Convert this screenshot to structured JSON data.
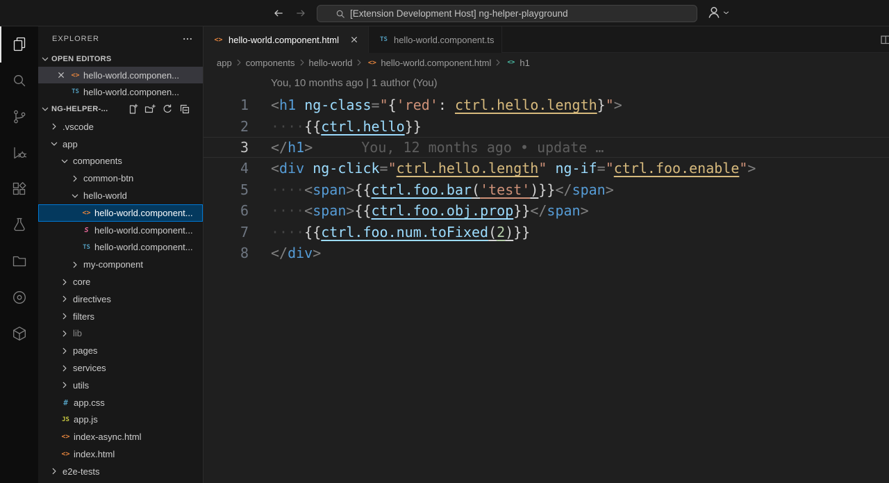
{
  "titlebar": {
    "search_text": "[Extension Development Host] ng-helper-playground"
  },
  "colors": {
    "accent": "#0078d4",
    "selection_bg": "#04395e",
    "html_icon": "#e0823d",
    "ts_icon": "#519aba",
    "js_icon": "#cbcb41",
    "style_icon": "#ec6a9c"
  },
  "activitybar": {
    "items": [
      {
        "name": "explorer-icon",
        "icon": "files",
        "active": true
      },
      {
        "name": "search-icon",
        "icon": "search"
      },
      {
        "name": "source-control-icon",
        "icon": "scm"
      },
      {
        "name": "run-debug-icon",
        "icon": "debug"
      },
      {
        "name": "extensions-icon",
        "icon": "ext"
      },
      {
        "name": "testing-icon",
        "icon": "beaker"
      },
      {
        "name": "folder-view-icon",
        "icon": "folder"
      },
      {
        "name": "live-preview-icon",
        "icon": "circle"
      },
      {
        "name": "package-icon",
        "icon": "cube"
      }
    ]
  },
  "sidebar": {
    "title": "EXPLORER",
    "open_editors_label": "OPEN EDITORS",
    "section_label": "NG-HELPER-...",
    "open_editors": [
      {
        "icon": "html",
        "label": "hello-world.componen...",
        "close": true,
        "active": true
      },
      {
        "icon": "ts",
        "label": "hello-world.componen..."
      }
    ],
    "tree": [
      {
        "indent": 0,
        "chevron": "right",
        "label": ".vscode"
      },
      {
        "indent": 0,
        "chevron": "down",
        "label": "app"
      },
      {
        "indent": 1,
        "chevron": "down",
        "label": "components"
      },
      {
        "indent": 2,
        "chevron": "right",
        "label": "common-btn"
      },
      {
        "indent": 2,
        "chevron": "down",
        "label": "hello-world"
      },
      {
        "indent": 3,
        "icon": "html",
        "label": "hello-world.component...",
        "selected": true
      },
      {
        "indent": 3,
        "icon": "style",
        "label": "hello-world.component..."
      },
      {
        "indent": 3,
        "icon": "ts",
        "label": "hello-world.component..."
      },
      {
        "indent": 2,
        "chevron": "right",
        "label": "my-component"
      },
      {
        "indent": 1,
        "chevron": "right",
        "label": "core"
      },
      {
        "indent": 1,
        "chevron": "right",
        "label": "directives"
      },
      {
        "indent": 1,
        "chevron": "right",
        "label": "filters"
      },
      {
        "indent": 1,
        "chevron": "right",
        "label": "lib",
        "dim": true
      },
      {
        "indent": 1,
        "chevron": "right",
        "label": "pages"
      },
      {
        "indent": 1,
        "chevron": "right",
        "label": "services"
      },
      {
        "indent": 1,
        "chevron": "right",
        "label": "utils"
      },
      {
        "indent": 1,
        "icon": "css",
        "label": "app.css"
      },
      {
        "indent": 1,
        "icon": "js",
        "label": "app.js"
      },
      {
        "indent": 1,
        "icon": "html",
        "label": "index-async.html"
      },
      {
        "indent": 1,
        "icon": "html",
        "label": "index.html"
      },
      {
        "indent": 0,
        "chevron": "right",
        "label": "e2e-tests"
      }
    ]
  },
  "editor": {
    "tabs": [
      {
        "icon": "html",
        "label": "hello-world.component.html",
        "active": true,
        "close": true
      },
      {
        "icon": "ts",
        "label": "hello-world.component.ts"
      }
    ],
    "breadcrumbs": [
      {
        "label": "app"
      },
      {
        "label": "components"
      },
      {
        "label": "hello-world"
      },
      {
        "icon": "html",
        "label": "hello-world.component.html"
      },
      {
        "icon": "sym",
        "label": "h1"
      }
    ],
    "codelens": "You, 10 months ago | 1 author (You)",
    "lines": [
      {
        "num": 1,
        "tokens": [
          {
            "t": "<",
            "c": "pun"
          },
          {
            "t": "h1",
            "c": "tag"
          },
          {
            "t": " ",
            "c": "pln"
          },
          {
            "t": "ng-class",
            "c": "attr"
          },
          {
            "t": "=",
            "c": "pun"
          },
          {
            "t": "\"",
            "c": "str"
          },
          {
            "t": "{",
            "c": "pun2"
          },
          {
            "t": "'red'",
            "c": "str"
          },
          {
            "t": ": ",
            "c": "pun2"
          },
          {
            "t": "ctrl.hello.length",
            "c": "lnk"
          },
          {
            "t": "}",
            "c": "pun2"
          },
          {
            "t": "\"",
            "c": "str"
          },
          {
            "t": ">",
            "c": "pun"
          }
        ]
      },
      {
        "num": 2,
        "tokens": [
          {
            "t": "····",
            "c": "ws"
          },
          {
            "t": "{{",
            "c": "pun2"
          },
          {
            "t": "ctrl.hello",
            "c": "ilnk"
          },
          {
            "t": "}}",
            "c": "pun2"
          }
        ]
      },
      {
        "num": 3,
        "current": true,
        "tokens": [
          {
            "t": "</",
            "c": "pun"
          },
          {
            "t": "h1",
            "c": "tag"
          },
          {
            "t": ">",
            "c": "pun"
          },
          {
            "t": "You, 12 months ago • update …",
            "c": "blame"
          }
        ]
      },
      {
        "num": 4,
        "tokens": [
          {
            "t": "<",
            "c": "pun"
          },
          {
            "t": "div",
            "c": "tag"
          },
          {
            "t": " ",
            "c": "pln"
          },
          {
            "t": "ng-click",
            "c": "attr"
          },
          {
            "t": "=",
            "c": "pun"
          },
          {
            "t": "\"",
            "c": "str"
          },
          {
            "t": "ctrl.hello.length",
            "c": "lnk"
          },
          {
            "t": "\"",
            "c": "str"
          },
          {
            "t": " ",
            "c": "pln"
          },
          {
            "t": "ng-if",
            "c": "attr"
          },
          {
            "t": "=",
            "c": "pun"
          },
          {
            "t": "\"",
            "c": "str"
          },
          {
            "t": "ctrl.foo.enable",
            "c": "lnk"
          },
          {
            "t": "\"",
            "c": "str"
          },
          {
            "t": ">",
            "c": "pun"
          }
        ]
      },
      {
        "num": 5,
        "tokens": [
          {
            "t": "····",
            "c": "ws"
          },
          {
            "t": "<",
            "c": "pun"
          },
          {
            "t": "span",
            "c": "tag"
          },
          {
            "t": ">",
            "c": "pun"
          },
          {
            "t": "{{",
            "c": "pun2"
          },
          {
            "t": "ctrl.foo.bar",
            "c": "ilnk"
          },
          {
            "t": "(",
            "c": "punu"
          },
          {
            "t": "'test'",
            "c": "stru"
          },
          {
            "t": ")",
            "c": "punu"
          },
          {
            "t": "}}",
            "c": "pun2"
          },
          {
            "t": "</",
            "c": "pun"
          },
          {
            "t": "span",
            "c": "tag"
          },
          {
            "t": ">",
            "c": "pun"
          }
        ]
      },
      {
        "num": 6,
        "tokens": [
          {
            "t": "····",
            "c": "ws"
          },
          {
            "t": "<",
            "c": "pun"
          },
          {
            "t": "span",
            "c": "tag"
          },
          {
            "t": ">",
            "c": "pun"
          },
          {
            "t": "{{",
            "c": "pun2"
          },
          {
            "t": "ctrl.foo.obj.prop",
            "c": "ilnk"
          },
          {
            "t": "}}",
            "c": "pun2"
          },
          {
            "t": "</",
            "c": "pun"
          },
          {
            "t": "span",
            "c": "tag"
          },
          {
            "t": ">",
            "c": "pun"
          }
        ]
      },
      {
        "num": 7,
        "tokens": [
          {
            "t": "····",
            "c": "ws"
          },
          {
            "t": "{{",
            "c": "pun2"
          },
          {
            "t": "ctrl.foo.num.toFixed",
            "c": "ilnk"
          },
          {
            "t": "(",
            "c": "punu"
          },
          {
            "t": "2",
            "c": "numu"
          },
          {
            "t": ")",
            "c": "punu"
          },
          {
            "t": "}}",
            "c": "pun2"
          }
        ]
      },
      {
        "num": 8,
        "tokens": [
          {
            "t": "</",
            "c": "pun"
          },
          {
            "t": "div",
            "c": "tag"
          },
          {
            "t": ">",
            "c": "pun"
          }
        ]
      }
    ]
  }
}
